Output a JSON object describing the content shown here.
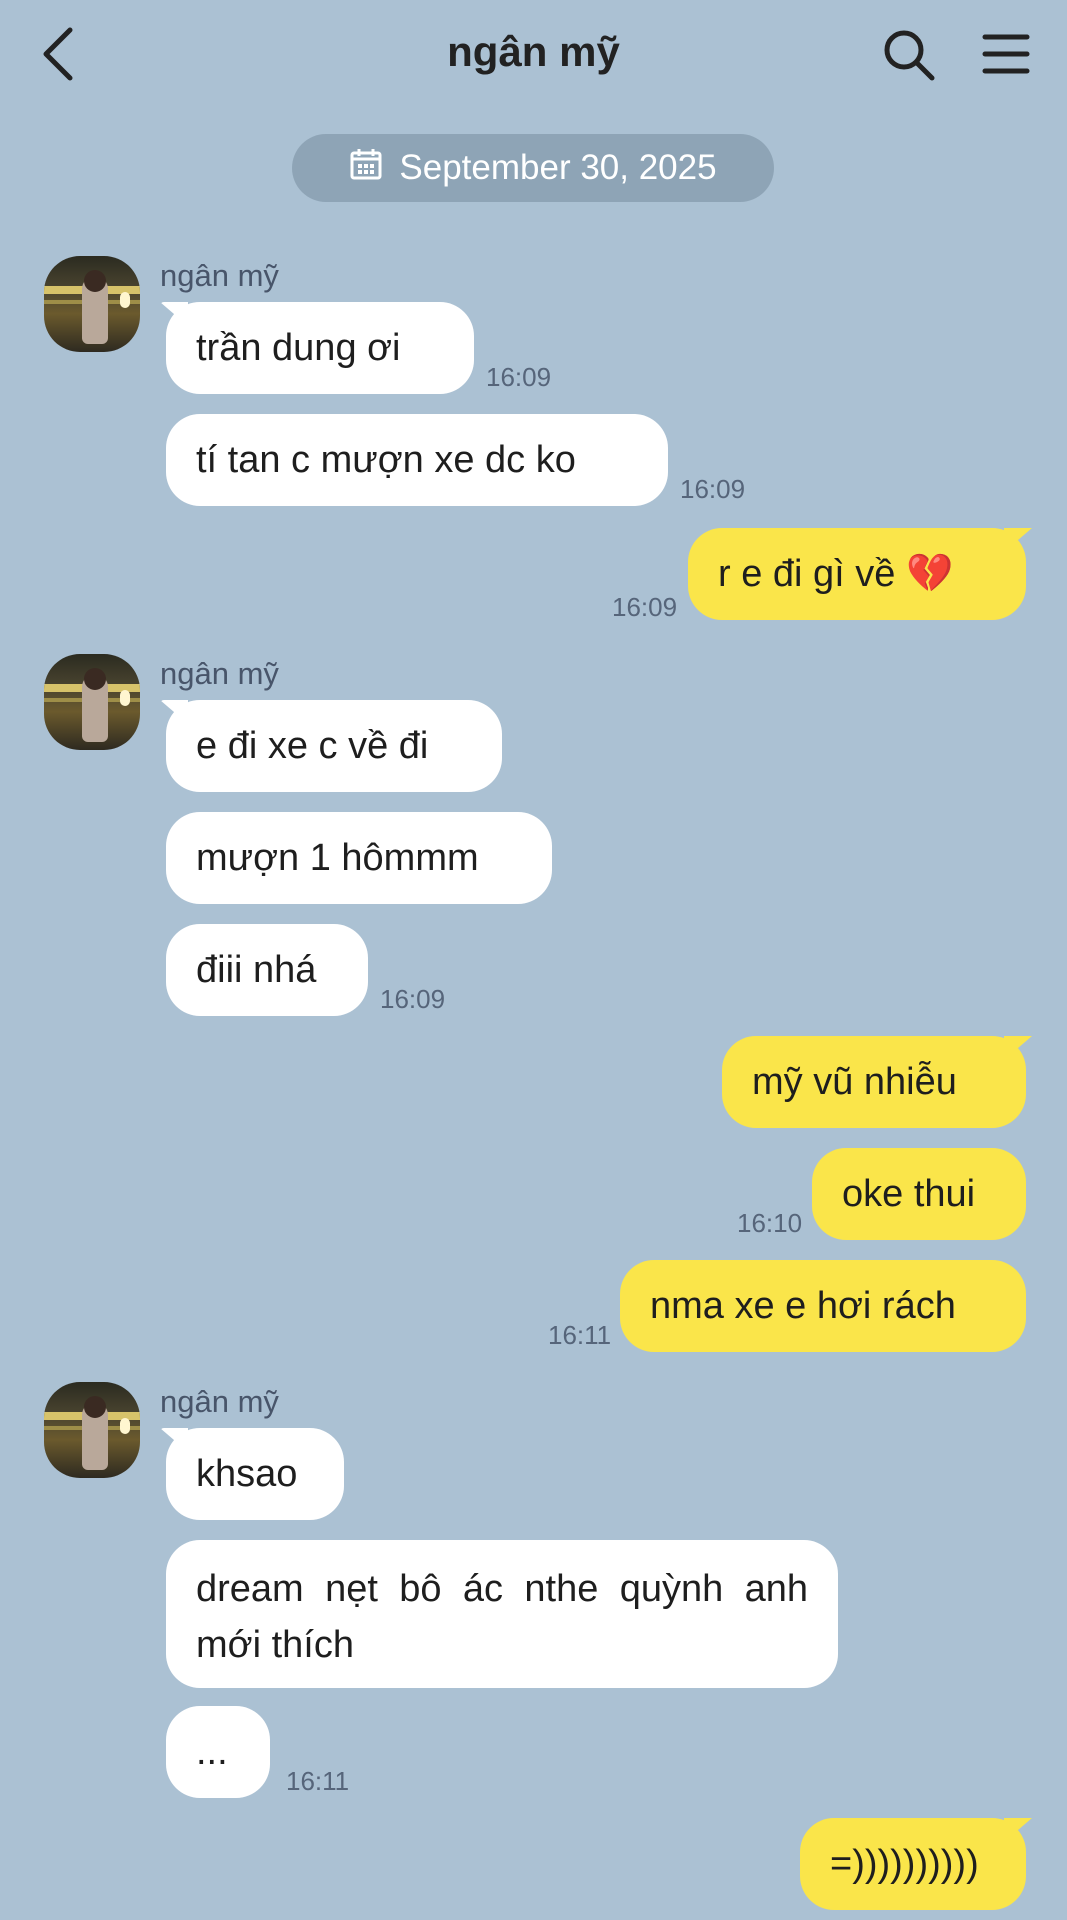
{
  "header": {
    "title": "ngân mỹ"
  },
  "date_divider": "September 30, 2025",
  "colors": {
    "background": "#abc1d3",
    "incoming_bubble": "#ffffff",
    "outgoing_bubble": "#fae54a"
  },
  "messages": [
    {
      "sender": "ngân mỹ",
      "text": "trần dung ơi",
      "time": "16:09"
    },
    {
      "text": "tí tan c mượn xe dc ko",
      "time": "16:09"
    },
    {
      "direction": "out",
      "text": "r e đi gì về 💔",
      "time": "16:09"
    },
    {
      "sender": "ngân mỹ",
      "text": "e đi xe c về đi"
    },
    {
      "text": "mượn 1 hômmm"
    },
    {
      "text": "điii nhá",
      "time": "16:09"
    },
    {
      "direction": "out",
      "text": "mỹ vũ nhiễu"
    },
    {
      "direction": "out",
      "text": "oke thui",
      "time": "16:10"
    },
    {
      "direction": "out",
      "text": "nma xe e hơi rách",
      "time": "16:11"
    },
    {
      "sender": "ngân mỹ",
      "text": "khsao"
    },
    {
      "text": "dream nẹt bô ác nthe quỳnh anh mới thích"
    },
    {
      "text": "...",
      "time": "16:11"
    },
    {
      "direction": "out",
      "text": "=))))))))))"
    }
  ]
}
